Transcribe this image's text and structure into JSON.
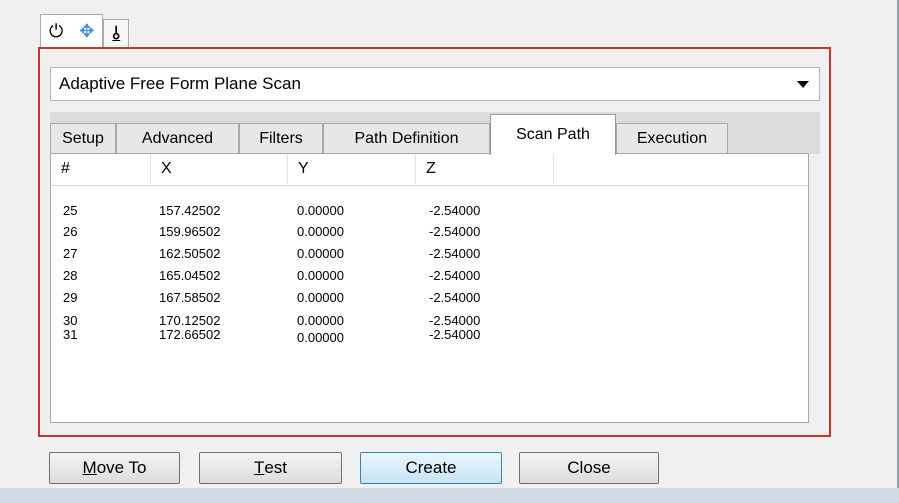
{
  "mode_tabs": [
    {
      "icon": "power-icon",
      "glyph": "⏻"
    },
    {
      "icon": "move-axes-icon",
      "glyph": "✥"
    },
    {
      "icon": "probe-icon",
      "glyph": "⫰"
    }
  ],
  "scan_type": {
    "value": "Adaptive Free Form Plane Scan"
  },
  "tabs": [
    "Setup",
    "Advanced",
    "Filters",
    "Path Definition",
    "Scan Path",
    "Execution"
  ],
  "active_tab": "Scan Path",
  "table": {
    "columns": [
      "#",
      "X",
      "Y",
      "Z"
    ],
    "rows": [
      {
        "n": "25",
        "x": "157.42502",
        "y": "0.00000",
        "z": "-2.54000"
      },
      {
        "n": "26",
        "x": "159.96502",
        "y": "0.00000",
        "z": "-2.54000"
      },
      {
        "n": "27",
        "x": "162.50502",
        "y": "0.00000",
        "z": "-2.54000"
      },
      {
        "n": "28",
        "x": "165.04502",
        "y": "0.00000",
        "z": "-2.54000"
      },
      {
        "n": "29",
        "x": "167.58502",
        "y": "0.00000",
        "z": "-2.54000"
      },
      {
        "n": "30",
        "x": "170.12502",
        "y": "0.00000",
        "z": "-2.54000"
      },
      {
        "n": "31",
        "x": "172.66502",
        "y": "0.00000",
        "z": "-2.54000"
      }
    ]
  },
  "buttons": {
    "move_to": {
      "mnemonic": "M",
      "rest": "ove To"
    },
    "test": {
      "mnemonic": "T",
      "rest": "est"
    },
    "create": "Create",
    "close": "Close"
  }
}
